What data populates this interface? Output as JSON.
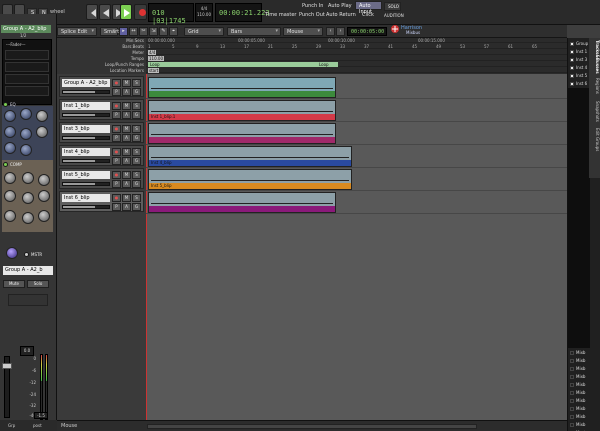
{
  "transport": {
    "label_s": "S",
    "label_n": "N",
    "playlist_name": "wheel",
    "clock_bbt": "010 |03|1745",
    "meter_top": "4/4",
    "tempo_small": "110.00",
    "clock_timecode": "00:00:21.223",
    "sync_label": "Time master",
    "punch_in": "Punch In",
    "punch_out": "Punch Out",
    "auto_play": "Auto Play",
    "auto_return": "Auto Return",
    "auto_input": "Auto Input",
    "click": "Click",
    "solo": "SOLO",
    "audition": "AUDITION",
    "logo_text": "Harrison Mixbus"
  },
  "toolbar": {
    "edit_mode": "Splice Edit",
    "ripple": "Smart",
    "snap": "Grid",
    "grid_units": "Bars",
    "zoom_focus": "Mouse",
    "nudge_clock": "00:00:05:00"
  },
  "rulers": {
    "labels": [
      "Min:Secs",
      "Bars:Beats",
      "Meter",
      "Tempo",
      "Loop/Punch Ranges",
      "Location Markers"
    ],
    "minsecs_ticks": [
      "00:00:00.000",
      "00:00:05.000",
      "00:00:10.000",
      "00:00:15.000"
    ],
    "bars_ticks": [
      "1",
      "5",
      "9",
      "13",
      "17",
      "21",
      "25",
      "29",
      "33",
      "37",
      "41",
      "45",
      "49",
      "53",
      "57",
      "61",
      "65"
    ],
    "meter_value": "4/4",
    "tempo_value": "110.00",
    "loop_label": "Loop",
    "loop_end_label": "Loop",
    "marker_label": "start"
  },
  "tracks": [
    {
      "name": "Group A - A2_blip",
      "region": "",
      "color": "#3c8a3c"
    },
    {
      "name": "Inst 1_blip",
      "region": "Inst 1_blip.1",
      "color": "#d43a48"
    },
    {
      "name": "Inst 3_blip",
      "region": "",
      "color": "#a02a6a"
    },
    {
      "name": "Inst 4_blip",
      "region": "Inst 4_blip",
      "color": "#2a4aa0"
    },
    {
      "name": "Inst 5_blip",
      "region": "Inst 5_blip",
      "color": "#d88a20"
    },
    {
      "name": "Inst 6_blip",
      "region": "",
      "color": "#8a1a7a"
    }
  ],
  "track_buttons": {
    "rec": "●",
    "mute": "M",
    "solo": "S",
    "play": "P",
    "auto": "A",
    "group": "G"
  },
  "strip": {
    "name": "Group A - A2_blip",
    "sub": "1/2",
    "fader_label": "---Fader---",
    "eq_label": "EQ",
    "comp_label": "COMP",
    "master_label": "MSTR",
    "bottom_name": "Group A - A2_b",
    "mute": "Mute",
    "solo": "Solo",
    "gain": "0.0",
    "peak": "-1.5",
    "scale": [
      "0",
      "-6",
      "-12",
      "-24",
      "-32",
      "-40"
    ],
    "bottom_left": "Grp",
    "bottom_right": "post"
  },
  "sidepanel": {
    "tabs": [
      "Tracks&Busses",
      "Regions",
      "Snapshots",
      "Edit Groups"
    ],
    "items": [
      "Group",
      "Inst 1",
      "Inst 3",
      "Inst 4",
      "Inst 5",
      "Inst 6"
    ],
    "bottom_items": [
      "Mixb",
      "Mixb",
      "Mixb",
      "Mixb",
      "Mixb",
      "Mixb",
      "Mixb",
      "Mixb",
      "Mixb",
      "Mixb",
      "Mast"
    ]
  },
  "bottombar": {
    "zoom_focus": "Mouse"
  }
}
